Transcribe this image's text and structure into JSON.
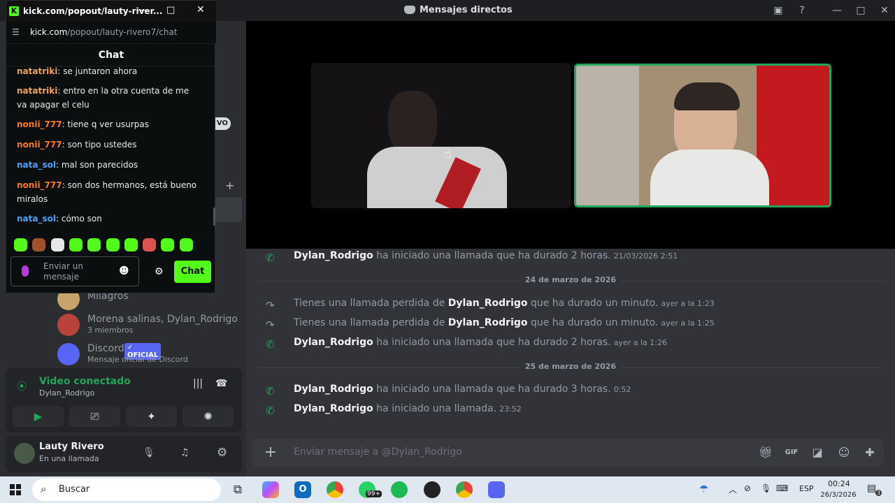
{
  "discord": {
    "window_title": "Mensajes directos",
    "sidebar": {
      "live_badge": "VO",
      "dms": [
        {
          "name": "Milagros",
          "sub": ""
        },
        {
          "name": "Morena salinas, Dylan_Rodrigo",
          "sub": "3 miembros"
        },
        {
          "name": "Discord",
          "badge": "✓ OFICIAL",
          "sub": "Mensaje oficial de Discord"
        }
      ],
      "voice": {
        "status": "Video conectado",
        "channel": "Dylan_Rodrigo"
      },
      "user": {
        "name": "Lauty Rivero",
        "status": "En una llamada"
      }
    },
    "messages": [
      {
        "type": "call",
        "user": "Dylan_Rodrigo",
        "text": "ha iniciado una llamada que ha durado 2 horas.",
        "time": "21/03/2026 2:51",
        "missed": false,
        "prefix": ""
      },
      {
        "type": "divider",
        "text": "24 de marzo de 2026"
      },
      {
        "type": "call",
        "prefix": "Tienes una llamada perdida de",
        "user": "Dylan_Rodrigo",
        "text": "que ha durado un minuto.",
        "time": "ayer a la 1:23",
        "missed": true
      },
      {
        "type": "call",
        "prefix": "Tienes una llamada perdida de",
        "user": "Dylan_Rodrigo",
        "text": "que ha durado un minuto.",
        "time": "ayer a la 1:25",
        "missed": true
      },
      {
        "type": "call",
        "prefix": "",
        "user": "Dylan_Rodrigo",
        "text": "ha iniciado una llamada que ha durado 2 horas.",
        "time": "ayer a la 1:26",
        "missed": false
      },
      {
        "type": "divider",
        "text": "25 de marzo de 2026"
      },
      {
        "type": "call",
        "prefix": "",
        "user": "Dylan_Rodrigo",
        "text": "ha iniciado una llamada que ha durado 3 horas.",
        "time": "0:52",
        "missed": false
      },
      {
        "type": "call",
        "prefix": "",
        "user": "Dylan_Rodrigo",
        "text": "ha iniciado una llamada.",
        "time": "23:52",
        "missed": false
      }
    ],
    "composer": {
      "placeholder": "Enviar mensaje a @Dylan_Rodrigo"
    },
    "composer_icons": [
      "gift-icon",
      "gif-icon",
      "sticker-icon",
      "emoji-icon",
      "apps-icon"
    ]
  },
  "kick": {
    "window_title": "kick.com/popout/lauty-river...",
    "url_domain": "kick.com",
    "url_path": "/popout/lauty-rivero7/chat",
    "header": "Chat",
    "messages": [
      {
        "user": "natatriki",
        "color": "#f4a35a",
        "text": "se juntaron ahora"
      },
      {
        "user": "natatriki",
        "color": "#f4a35a",
        "text": "entro en la otra cuenta de me va apagar el celu"
      },
      {
        "user": "nonii_777",
        "color": "#ff7a1a",
        "text": "tiene q ver usurpas"
      },
      {
        "user": "nonii_777",
        "color": "#ff7a1a",
        "text": "son tipo ustedes"
      },
      {
        "user": "nata_sol",
        "color": "#4aa3ff",
        "text": "mal son parecidos"
      },
      {
        "user": "nonii_777",
        "color": "#ff7a1a",
        "text": "son dos hermanos, está bueno miralos"
      },
      {
        "user": "nata_sol",
        "color": "#4aa3ff",
        "text": "cómo son"
      }
    ],
    "input_placeholder": "Enviar un mensaje",
    "send_label": "Chat"
  },
  "taskbar": {
    "search_placeholder": "Buscar",
    "whatsapp_badge": "99+",
    "language": "ESP",
    "time": "00:24",
    "date": "26/3/2026",
    "notif_count": "3"
  }
}
